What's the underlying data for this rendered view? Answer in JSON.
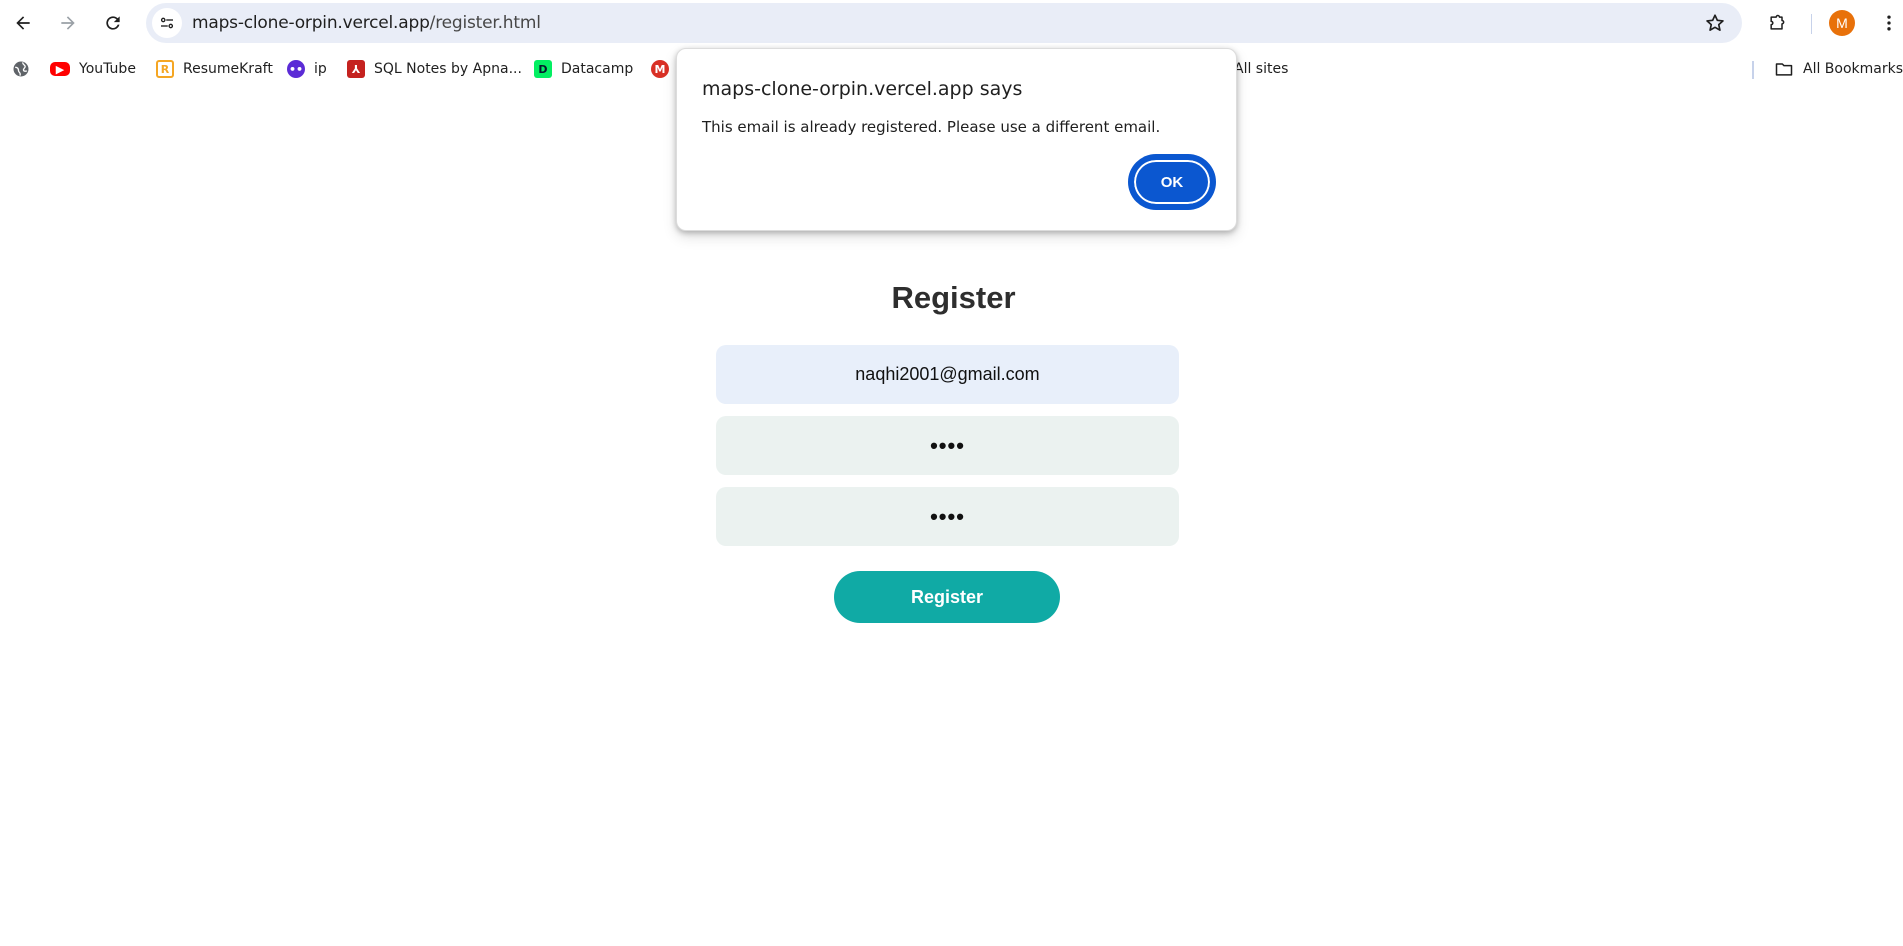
{
  "browser": {
    "url_host": "maps-clone-orpin.vercel.app",
    "url_path": "/register.html",
    "profile_initial": "M",
    "bookmarks": [
      {
        "label": "YouTube",
        "icon": "youtube-icon",
        "color": "#ff0000"
      },
      {
        "label": "ResumeKraft",
        "icon": "resumekraft-icon",
        "color": "#f5a623"
      },
      {
        "label": "ip",
        "icon": "ip-icon",
        "color": "#5b2bd6"
      },
      {
        "label": "SQL Notes by Apna...",
        "icon": "pdf-icon",
        "color": "#c5221f"
      },
      {
        "label": "Datacamp",
        "icon": "datacamp-icon",
        "color": "#03ef62"
      },
      {
        "label": "",
        "icon": "gmail-icon",
        "color": "#d93025"
      },
      {
        "label": "All sites",
        "icon": "",
        "color": ""
      }
    ],
    "all_bookmarks_label": "All Bookmarks"
  },
  "page": {
    "title": "Register",
    "email_value": "naqhi2001@gmail.com",
    "password_value": "••••",
    "confirm_password_value": "••••",
    "register_button": "Register",
    "accent_color": "#10aaa5"
  },
  "dialog": {
    "title": "maps-clone-orpin.vercel.app says",
    "message": "This email is already registered. Please use a different email.",
    "ok_label": "OK"
  }
}
